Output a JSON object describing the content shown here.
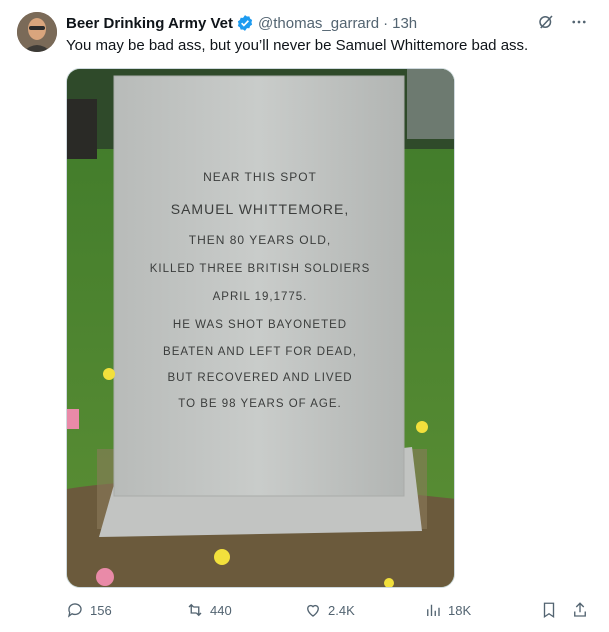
{
  "tweet": {
    "author_name": "Beer Drinking Army Vet",
    "handle": "@thomas_garrard",
    "separator": "·",
    "time": "13h",
    "text": "You may be bad ass, but you’ll never be Samuel Whittemore bad ass."
  },
  "image": {
    "inscription": [
      "NEAR THIS SPOT",
      "SAMUEL WHITTEMORE,",
      "THEN 80 YEARS OLD,",
      "KILLED THREE BRITISH SOLDIERS",
      "APRIL 19,1775.",
      "HE WAS SHOT BAYONETED",
      "BEATEN AND LEFT FOR DEAD,",
      "BUT RECOVERED AND LIVED",
      "TO BE 98 YEARS OF AGE."
    ]
  },
  "actions": {
    "replies": "156",
    "retweets": "440",
    "likes": "2.4K",
    "views": "18K"
  },
  "icons": [
    "grok-icon",
    "more-icon",
    "verified-badge-icon",
    "reply-icon",
    "retweet-icon",
    "like-icon",
    "views-icon",
    "bookmark-icon",
    "share-icon"
  ],
  "colors": {
    "verified": "#1d9bf0",
    "secondary_text": "#536471"
  }
}
